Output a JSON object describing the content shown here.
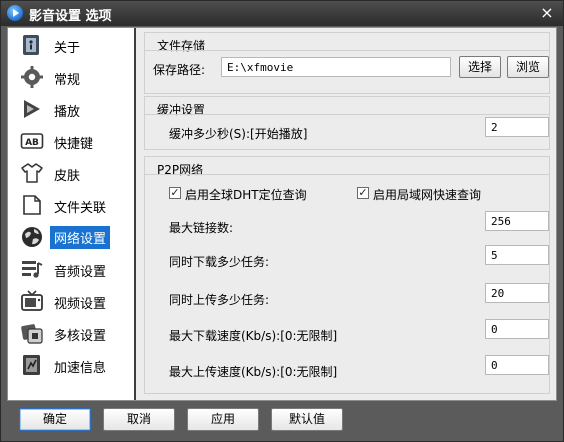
{
  "window": {
    "title": "影音设置 选项",
    "close_glyph": "×"
  },
  "sidebar": {
    "items": [
      {
        "label": "关于",
        "icon": "info-icon"
      },
      {
        "label": "常规",
        "icon": "gear-icon"
      },
      {
        "label": "播放",
        "icon": "play-icon"
      },
      {
        "label": "快捷键",
        "icon": "keyboard-icon"
      },
      {
        "label": "皮肤",
        "icon": "shirt-icon"
      },
      {
        "label": "文件关联",
        "icon": "file-icon"
      },
      {
        "label": "网络设置",
        "icon": "network-icon",
        "active": true
      },
      {
        "label": "音频设置",
        "icon": "audio-icon"
      },
      {
        "label": "视频设置",
        "icon": "tv-icon"
      },
      {
        "label": "多核设置",
        "icon": "cpu-icon"
      },
      {
        "label": "加速信息",
        "icon": "speed-icon"
      }
    ],
    "ab_text": "AB"
  },
  "storage": {
    "title": "文件存储",
    "path_label": "保存路径:",
    "path_value": "E:\\xfmovie",
    "choose_label": "选择",
    "browse_label": "浏览"
  },
  "buffer": {
    "title": "缓冲设置",
    "seconds_label": "缓冲多少秒(S):[开始播放]",
    "seconds_value": "2"
  },
  "p2p": {
    "title": "P2P网络",
    "dht_label": "启用全球DHT定位查询",
    "lan_label": "启用局域网快速查询",
    "check_glyph": "✓",
    "max_conn_label": "最大链接数:",
    "max_conn_value": "256",
    "dl_tasks_label": "同时下载多少任务:",
    "dl_tasks_value": "5",
    "ul_tasks_label": "同时上传多少任务:",
    "ul_tasks_value": "20",
    "max_dl_label": "最大下载速度(Kb/s):[0:无限制]",
    "max_dl_value": "0",
    "max_ul_label": "最大上传速度(Kb/s):[0:无限制]",
    "max_ul_value": "0"
  },
  "footer": {
    "ok": "确定",
    "cancel": "取消",
    "apply": "应用",
    "default": "默认值"
  },
  "colors": {
    "accent": "#1a72d0",
    "titlebar": "#3a3a3a",
    "panel": "#ececec"
  }
}
